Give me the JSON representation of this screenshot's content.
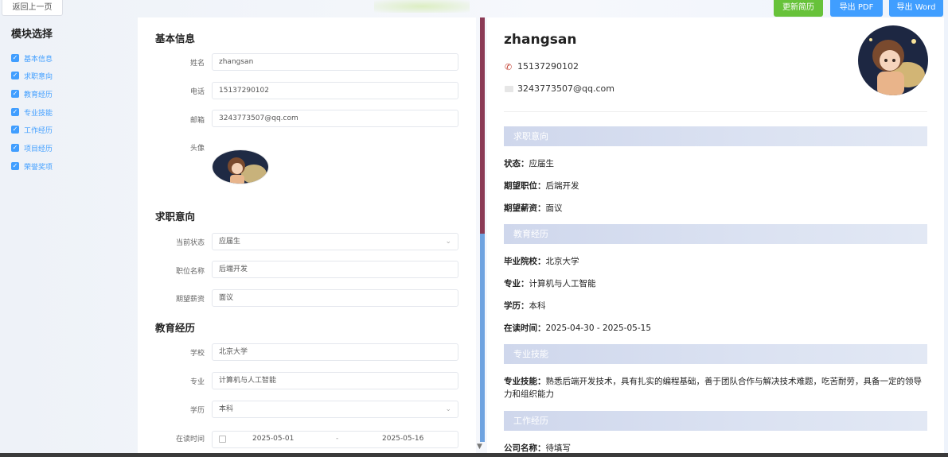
{
  "toolbar": {
    "back_label": "返回上一页",
    "update_label": "更新简历",
    "export_pdf_label": "导出 PDF",
    "export_word_label": "导出 Word",
    "colors": {
      "update": "#67c23a",
      "export": "#409eff"
    }
  },
  "sidebar": {
    "title": "模块选择",
    "items": [
      {
        "label": "基本信息",
        "checked": true
      },
      {
        "label": "求职意向",
        "checked": true
      },
      {
        "label": "教育经历",
        "checked": true
      },
      {
        "label": "专业技能",
        "checked": true
      },
      {
        "label": "工作经历",
        "checked": true
      },
      {
        "label": "项目经历",
        "checked": true
      },
      {
        "label": "荣誉奖项",
        "checked": true
      }
    ]
  },
  "form": {
    "basic": {
      "title": "基本信息",
      "name_label": "姓名",
      "name_value": "zhangsan",
      "phone_label": "电话",
      "phone_value": "15137290102",
      "email_label": "邮箱",
      "email_value": "3243773507@qq.com",
      "avatar_label": "头像"
    },
    "intent": {
      "title": "求职意向",
      "status_label": "当前状态",
      "status_value": "应届生",
      "position_label": "职位名称",
      "position_value": "后端开发",
      "salary_label": "期望薪资",
      "salary_value": "面议"
    },
    "education": {
      "title": "教育经历",
      "school_label": "学校",
      "school_value": "北京大学",
      "major_label": "专业",
      "major_value": "计算机与人工智能",
      "degree_label": "学历",
      "degree_value": "本科",
      "period_label": "在读时间",
      "start_date": "2025-05-01",
      "date_separator": "-",
      "end_date": "2025-05-16"
    }
  },
  "preview": {
    "name": "zhangsan",
    "phone": "15137290102",
    "email": "3243773507@qq.com",
    "sections": {
      "intent": "求职意向",
      "education": "教育经历",
      "skills": "专业技能",
      "work": "工作经历"
    },
    "intent_lines": {
      "status_key": "状态：",
      "status_val": "应届生",
      "position_key": "期望职位：",
      "position_val": "后端开发",
      "salary_key": "期望薪资：",
      "salary_val": "面议"
    },
    "education_lines": {
      "school_key": "毕业院校：",
      "school_val": "北京大学",
      "major_key": "专业：",
      "major_val": "计算机与人工智能",
      "degree_key": "学历：",
      "degree_val": "本科",
      "period_key": "在读时间：",
      "period_val": "2025-04-30 - 2025-05-15"
    },
    "skills_key": "专业技能：",
    "skills_val": "熟悉后端开发技术，具有扎实的编程基础，善于团队合作与解决技术难题，吃苦耐劳，具备一定的领导力和组织能力",
    "work_company_key": "公司名称：",
    "work_company_val": "待填写"
  }
}
